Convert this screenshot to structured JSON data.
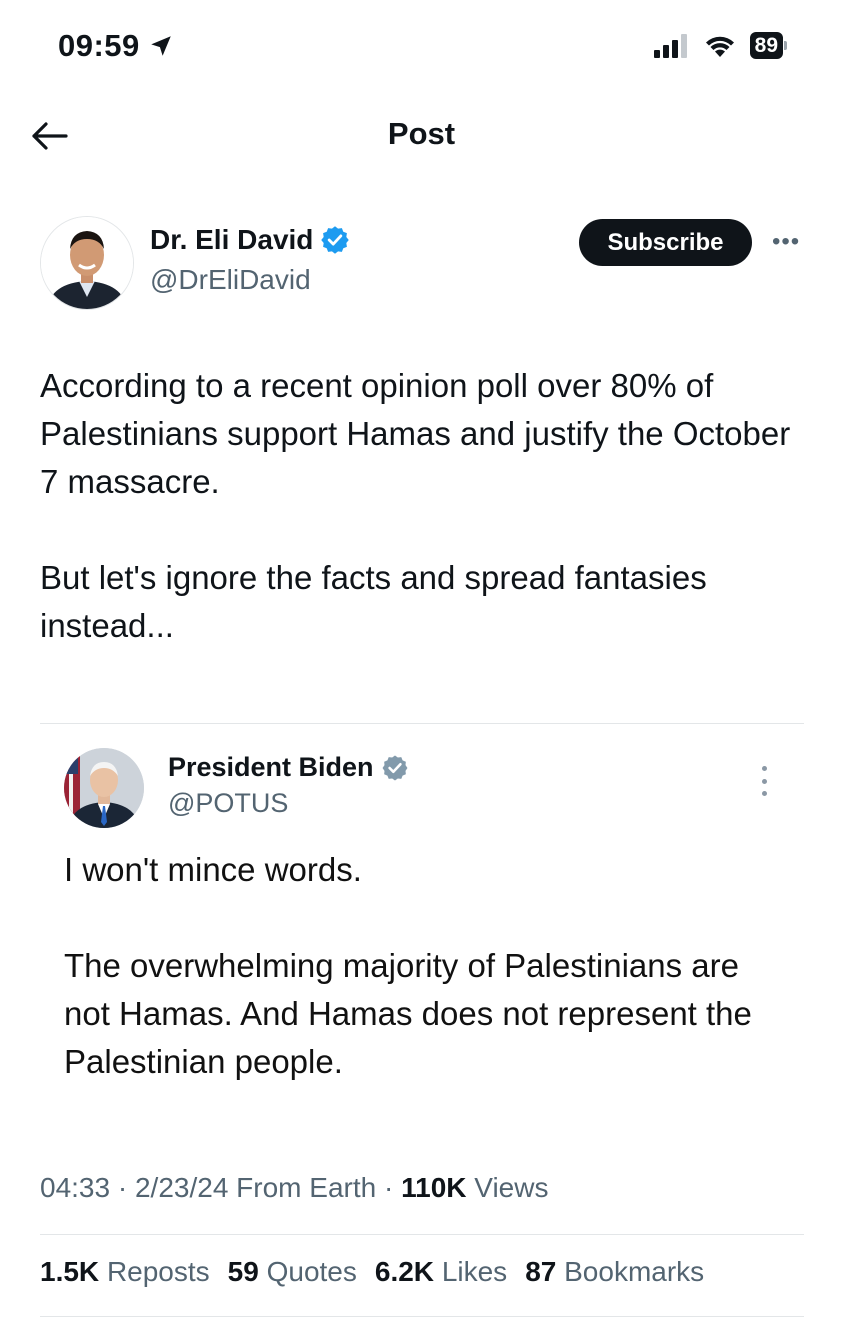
{
  "status_bar": {
    "time": "09:59",
    "battery": "89"
  },
  "header": {
    "title": "Post"
  },
  "author": {
    "name": "Dr. Eli David",
    "handle": "@DrEliDavid",
    "subscribe_label": "Subscribe"
  },
  "post": {
    "paragraphs": [
      "According to a recent opinion poll over 80% of Palestinians support Hamas and justify the October 7 massacre.",
      "But let's ignore the facts and spread fantasies instead..."
    ]
  },
  "quoted_post": {
    "name": "President Biden",
    "handle": "@POTUS",
    "paragraphs": [
      "I won't mince words.",
      "The overwhelming majority of Palestinians are not Hamas. And Hamas does not represent the Palestinian people."
    ]
  },
  "meta": {
    "time": "04:33",
    "date": "2/23/24",
    "location": "From Earth",
    "views_count": "110K",
    "views_label": "Views"
  },
  "stats": {
    "reposts_count": "1.5K",
    "reposts_label": "Reposts",
    "quotes_count": "59",
    "quotes_label": "Quotes",
    "likes_count": "6.2K",
    "likes_label": "Likes",
    "bookmarks_count": "87",
    "bookmarks_label": "Bookmarks"
  },
  "colors": {
    "verified_blue": "#1d9bf0",
    "verified_gray": "#829aab",
    "secondary_text": "#536471"
  }
}
